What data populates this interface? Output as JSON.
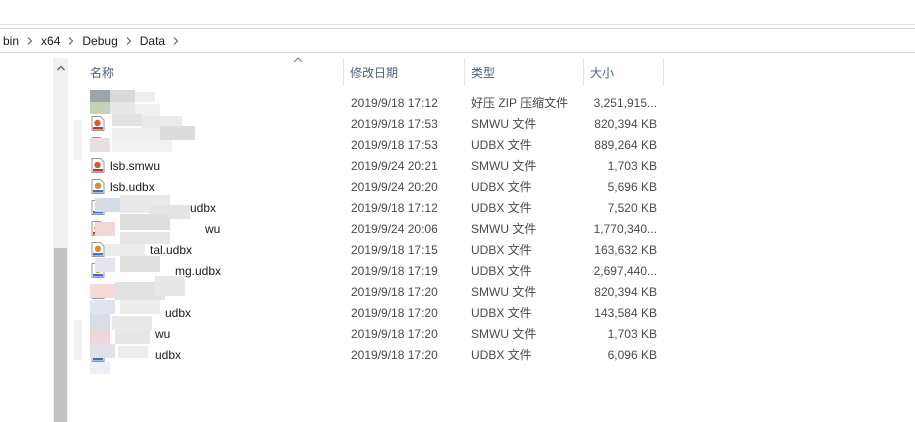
{
  "breadcrumb": [
    "bin",
    "x64",
    "Debug",
    "Data"
  ],
  "columns": {
    "name": "名称",
    "date": "修改日期",
    "type": "类型",
    "size": "大小"
  },
  "files": [
    {
      "name": "",
      "date": "2019/9/18 17:12",
      "type": "好压 ZIP 压缩文件",
      "size": "3,251,915...",
      "icon": "zip-icon"
    },
    {
      "name": "",
      "date": "2019/9/18 17:53",
      "type": "SMWU 文件",
      "size": "820,394 KB",
      "icon": "smwu-file-icon"
    },
    {
      "name": "",
      "date": "2019/9/18 17:53",
      "type": "UDBX 文件",
      "size": "889,264 KB",
      "icon": "udbx-file-icon"
    },
    {
      "name": "lsb.smwu",
      "date": "2019/9/24 20:21",
      "type": "SMWU 文件",
      "size": "1,703 KB",
      "icon": "smwu-file-icon"
    },
    {
      "name": "lsb.udbx",
      "date": "2019/9/24 20:20",
      "type": "UDBX 文件",
      "size": "5,696 KB",
      "icon": "udbx-file-icon"
    },
    {
      "name": "udbx",
      "date": "2019/9/18 17:12",
      "type": "UDBX 文件",
      "size": "7,520 KB",
      "icon": "udbx-file-icon"
    },
    {
      "name": "wu",
      "date": "2019/9/24 20:06",
      "type": "SMWU 文件",
      "size": "1,770,340...",
      "icon": "smwu-file-icon"
    },
    {
      "name": "tal.udbx",
      "date": "2019/9/18 17:15",
      "type": "UDBX 文件",
      "size": "163,632 KB",
      "icon": "udbx-file-icon"
    },
    {
      "name": "mg.udbx",
      "date": "2019/9/18 17:19",
      "type": "UDBX 文件",
      "size": "2,697,440...",
      "icon": "udbx-file-icon"
    },
    {
      "name": "",
      "date": "2019/9/18 17:20",
      "type": "SMWU 文件",
      "size": "820,394 KB",
      "icon": "smwu-file-icon"
    },
    {
      "name": "udbx",
      "date": "2019/9/18 17:20",
      "type": "UDBX 文件",
      "size": "143,584 KB",
      "icon": "udbx-file-icon"
    },
    {
      "name": "wu",
      "date": "2019/9/18 17:20",
      "type": "SMWU 文件",
      "size": "1,703 KB",
      "icon": "smwu-file-icon"
    },
    {
      "name": "udbx",
      "date": "2019/9/18 17:20",
      "type": "UDBX 文件",
      "size": "6,096 KB",
      "icon": "udbx-file-icon"
    }
  ]
}
